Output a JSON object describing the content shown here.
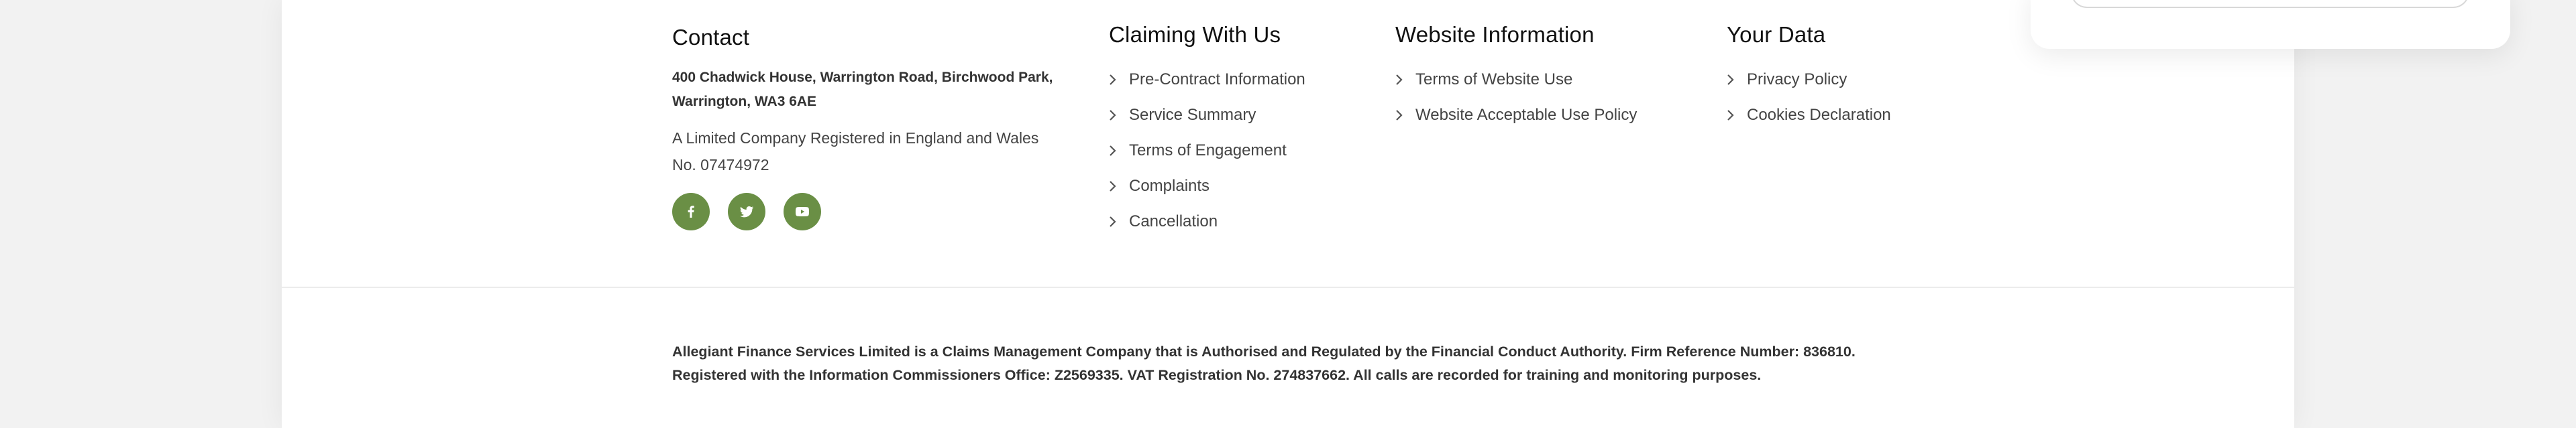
{
  "contact": {
    "title": "Contact",
    "address": "400 Chadwick House, Warrington Road, Birchwood Park, Warrington, WA3 6AE",
    "company": "A Limited Company Registered in England and Wales No. 07474972",
    "social": [
      {
        "icon": "facebook-icon"
      },
      {
        "icon": "twitter-icon"
      },
      {
        "icon": "youtube-icon"
      }
    ]
  },
  "claiming": {
    "title": "Claiming With Us",
    "links": [
      "Pre-Contract Information",
      "Service Summary",
      "Terms of Engagement",
      "Complaints",
      "Cancellation"
    ]
  },
  "website": {
    "title": "Website Information",
    "links": [
      "Terms of Website Use",
      "Website Acceptable Use Policy"
    ]
  },
  "data": {
    "title": "Your Data",
    "links": [
      "Privacy Policy",
      "Cookies Declaration"
    ]
  },
  "legal": {
    "line1": "Allegiant Finance Services Limited is a Claims Management Company that is Authorised and Regulated by the Financial Conduct Authority. Firm Reference Number: 836810.",
    "line2": "Registered with the Information Commissioners Office: Z2569335. VAT Registration No. 274837662. All calls are recorded for training and monitoring purposes."
  },
  "colors": {
    "accent": "#6a8f45",
    "text": "#444444",
    "heading": "#111111",
    "background": "#f2f2f2"
  }
}
